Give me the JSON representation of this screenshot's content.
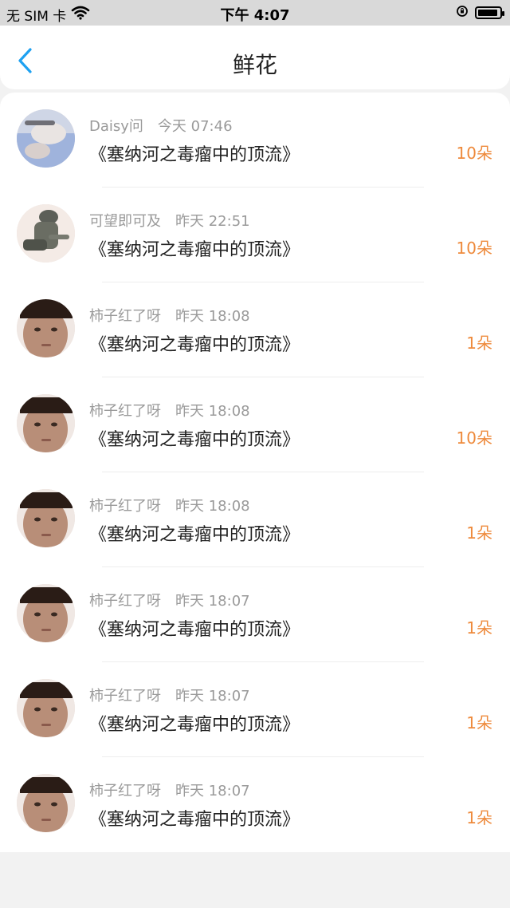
{
  "status_bar": {
    "carrier": "无 SIM 卡",
    "time": "下午 4:07"
  },
  "nav": {
    "title": "鲜花"
  },
  "items": [
    {
      "user": "Daisy问",
      "time": "今天 07:46",
      "book": "《塞纳河之毒瘤中的顶流》",
      "count": "10朵",
      "avatar": "photo"
    },
    {
      "user": "可望即可及",
      "time": "昨天 22:51",
      "book": "《塞纳河之毒瘤中的顶流》",
      "count": "10朵",
      "avatar": "soldier"
    },
    {
      "user": "柿子红了呀",
      "time": "昨天 18:08",
      "book": "《塞纳河之毒瘤中的顶流》",
      "count": "1朵",
      "avatar": "face"
    },
    {
      "user": "柿子红了呀",
      "time": "昨天 18:08",
      "book": "《塞纳河之毒瘤中的顶流》",
      "count": "10朵",
      "avatar": "face"
    },
    {
      "user": "柿子红了呀",
      "time": "昨天 18:08",
      "book": "《塞纳河之毒瘤中的顶流》",
      "count": "1朵",
      "avatar": "face"
    },
    {
      "user": "柿子红了呀",
      "time": "昨天 18:07",
      "book": "《塞纳河之毒瘤中的顶流》",
      "count": "1朵",
      "avatar": "face"
    },
    {
      "user": "柿子红了呀",
      "time": "昨天 18:07",
      "book": "《塞纳河之毒瘤中的顶流》",
      "count": "1朵",
      "avatar": "face"
    },
    {
      "user": "柿子红了呀",
      "time": "昨天 18:07",
      "book": "《塞纳河之毒瘤中的顶流》",
      "count": "1朵",
      "avatar": "face"
    }
  ]
}
